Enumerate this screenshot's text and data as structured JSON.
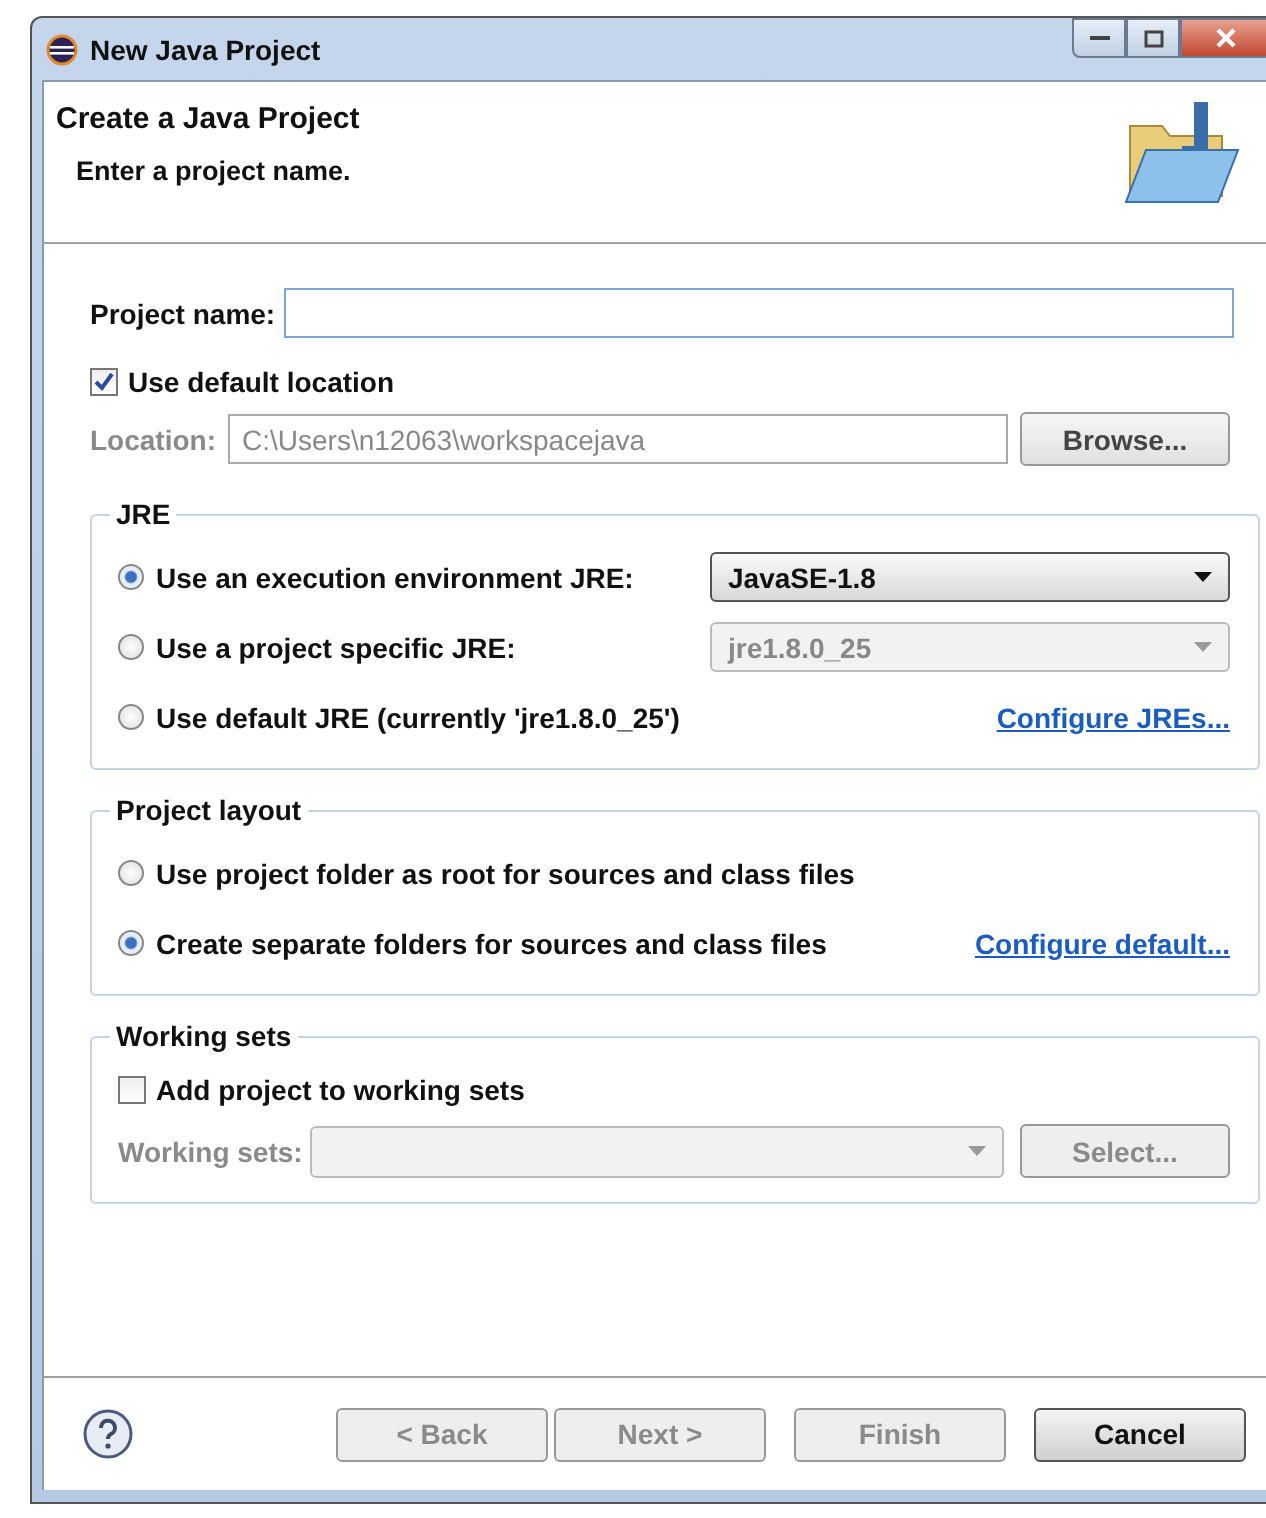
{
  "window": {
    "title": "New Java Project"
  },
  "header": {
    "title": "Create a Java Project",
    "message": "Enter a project name."
  },
  "project_name": {
    "label": "Project name:"
  },
  "use_default_location": {
    "label": "Use default location",
    "checked": true
  },
  "location": {
    "label": "Location:",
    "value": "C:\\Users\\n12063\\workspacejava",
    "disabled": true,
    "button": "Browse..."
  },
  "jre": {
    "title": "JRE",
    "options": [
      {
        "label": "Use an execution environment JRE:",
        "selected": true,
        "kind": "combo",
        "combo": "JavaSE-1.8",
        "disabled": false
      },
      {
        "label": "Use a project specific JRE:",
        "selected": false,
        "kind": "combo",
        "combo": "jre1.8.0_25",
        "disabled": true
      },
      {
        "label": "Use default JRE (currently 'jre1.8.0_25')",
        "selected": false,
        "kind": "link",
        "link": "Configure JREs..."
      }
    ]
  },
  "project_layout": {
    "title": "Project layout",
    "options": [
      {
        "label": "Use project folder as root for sources and class files",
        "selected": false
      },
      {
        "label": "Create separate folders for sources and class files",
        "selected": true
      }
    ],
    "link": "Configure default..."
  },
  "working_sets": {
    "title": "Working sets",
    "add": {
      "label": "Add project to working sets",
      "checked": false
    },
    "field_label": "Working sets:",
    "disabled": true,
    "button": "Select..."
  },
  "buttons": [
    {
      "label": "< Back",
      "disabled": true,
      "default": false
    },
    {
      "label": "Next >",
      "disabled": true,
      "default": false
    },
    {
      "label": "Finish",
      "disabled": true,
      "default": false
    },
    {
      "label": "Cancel",
      "disabled": false,
      "default": true
    }
  ]
}
